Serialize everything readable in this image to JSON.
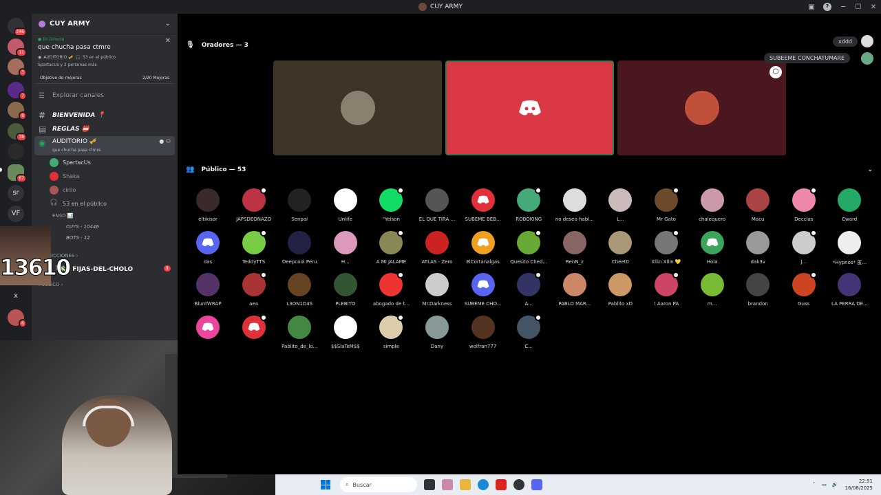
{
  "window": {
    "title": "CUY ARMY"
  },
  "rail": {
    "dm_badge": "246",
    "badges": [
      "11",
      "3",
      "7",
      "8",
      "78",
      "67",
      "6"
    ],
    "text_items": [
      "sr",
      "VF",
      "x"
    ]
  },
  "sidebar": {
    "guild_name": "CUY ARMY",
    "live": {
      "tag": "En Directo",
      "title": "que chucha pasa ctmre",
      "channel": "AUDITORIO 🎺",
      "audience": "53 en el público",
      "speakers": "SpartacUs y 2 personas más"
    },
    "boost": {
      "label": "Objetivo de mejoras",
      "progress": "2/20 Mejoras"
    },
    "explore": "Explorar canales",
    "channels": [
      {
        "name": "BIENVENIDA 📍"
      },
      {
        "name": "REGLAS 📛"
      }
    ],
    "stage_channel": {
      "name": "AUDITORIO 🎺",
      "topic": "que chucha pasa ctmre"
    },
    "voice_users": [
      "SpartacUs",
      "Shaka",
      "cirilo"
    ],
    "audience_row": "53 en el público",
    "partial_cat": "ENSO 📊",
    "cuys": "CUYS : 10446",
    "bots": "BOTS : 12",
    "cat_predicciones": "PREDICCIONES",
    "fijas": "『💸』FIJAS-DEL-CHOLO",
    "fijas_badge": "1",
    "cat_publico": "PUBLICO"
  },
  "overlay": {
    "counter": "13610"
  },
  "stage": {
    "speakers_title": "Oradores — 3",
    "audience_title": "Público — 53",
    "chips": [
      "xddd",
      "SUBEEME CONCHATUMARE"
    ],
    "audience": [
      "eltikisor",
      "JAPSDEONAZO",
      "Senpai",
      "Unlife",
      "\"Yeison",
      "EL QUE TIRA ...",
      "SUBEME BEB...",
      "ROBOKING",
      "no deseo habl...",
      "L...",
      "Mr Gato",
      "chalequero",
      "Macu",
      "Decclas",
      "Eward",
      "das",
      "TeddyTTS",
      "Deepcool Peru",
      "H...",
      "A MI JALAME",
      "ATLAS - Zero",
      "ElCortanalgas",
      "Quesito Ched...",
      "RenN_z",
      "Cheet0",
      "Xllin Xllin 💛",
      "Hola",
      "dak3v",
      "J...",
      "*Hypnos* 匿...",
      "BluntWRAP",
      "aea",
      "L3ON1D4S",
      "PLEBITO",
      "abogado de t...",
      "Mr.Darkness",
      "SUBEME CHO...",
      "A...",
      "PABLO MAR...",
      "Pablito xD",
      "! Aaron PA",
      "m...",
      "brandon",
      "Guss",
      "LA PERRA DE...",
      "",
      "",
      "Pablito_de_lo...",
      "$$SlaTeM$$",
      "simple",
      "Dany",
      "wolfran777",
      "C..."
    ],
    "colors": [
      "#3a2a2a",
      "#b34",
      "#222",
      "#ffffff",
      "#1d6",
      "#555",
      "#e0313b",
      "#4a7",
      "#ddd",
      "#cbb",
      "#6a4a2a",
      "#c9a",
      "#a44",
      "#e8a",
      "#2a6",
      "#5865f2",
      "#7c4",
      "#224",
      "#d9b",
      "#885",
      "#c22",
      "#f0a020",
      "#6a3",
      "#866",
      "#a97",
      "#777",
      "#3ba55c",
      "#999",
      "#ccc",
      "#eee",
      "#536",
      "#a33",
      "#642",
      "#353",
      "#e33",
      "#ccc",
      "#5865f2",
      "#336",
      "#c86",
      "#c96",
      "#c46",
      "#7b3",
      "#444",
      "#c42",
      "#437",
      "#eb459e",
      "#e0313b",
      "#484",
      "#fff",
      "#dca",
      "#899",
      "#532",
      "#456"
    ],
    "discord_default": [
      6,
      15,
      21,
      26,
      36,
      45,
      46
    ]
  },
  "taskbar": {
    "search": "Buscar",
    "time": "22:51",
    "date": "16/08/2025"
  }
}
